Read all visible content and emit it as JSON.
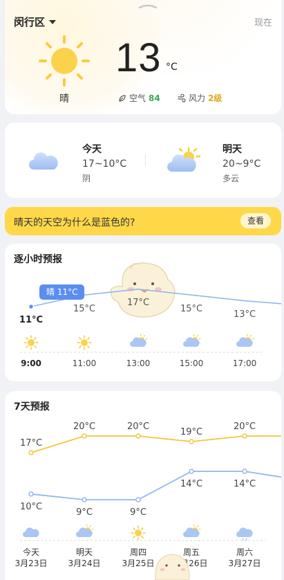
{
  "current": {
    "location": "闵行区",
    "now_label": "现在",
    "temperature": "13",
    "unit": "°C",
    "condition": "晴",
    "air_label": "空气",
    "air_value": "84",
    "wind_label": "风力",
    "wind_value": "2级",
    "colors": {
      "air": "#3aa855",
      "wind": "#e3a518"
    }
  },
  "today": {
    "title": "今天",
    "range": "17~10°C",
    "condition": "阴",
    "icon": "cloud-icon"
  },
  "tomorrow": {
    "title": "明天",
    "range": "20~9°C",
    "condition": "多云",
    "icon": "partly-cloudy-icon"
  },
  "banner": {
    "text": "晴天的天空为什么是蓝色的?",
    "button": "查看"
  },
  "hourly": {
    "title": "逐小时预报",
    "tooltip": "晴 11°C",
    "chart_data": {
      "type": "line",
      "x": [
        "9:00",
        "11:00",
        "13:00",
        "15:00",
        "17:00"
      ],
      "series": [
        {
          "values": [
            11,
            15,
            17,
            15,
            13
          ]
        }
      ],
      "labels": [
        "11°C",
        "15°C",
        "17°C",
        "15°C",
        "13°C"
      ],
      "icons": [
        "sun-icon",
        "sun-icon",
        "partly-cloudy-icon",
        "partly-cloudy-icon",
        "partly-cloudy-icon"
      ]
    }
  },
  "weekly": {
    "title": "7天预报",
    "chart_data": {
      "type": "line",
      "days": [
        "今天",
        "明天",
        "周四",
        "周五",
        "周六"
      ],
      "dates": [
        "3月23日",
        "3月24日",
        "3月25日",
        "3月26日",
        "3月27日"
      ],
      "series": [
        {
          "values": [
            17,
            20,
            20,
            19,
            20
          ],
          "labels": [
            "17°C",
            "20°C",
            "20°C",
            "19°C",
            "20°C"
          ]
        },
        {
          "values": [
            10,
            9,
            9,
            14,
            14
          ],
          "labels": [
            "10°C",
            "9°C",
            "9°C",
            "14°C",
            "14°C"
          ]
        }
      ],
      "colors": {
        "high": "#f5c53d",
        "low": "#8fb7f2"
      },
      "icons": [
        "cloud-icon",
        "partly-cloudy-icon",
        "sun-icon",
        "partly-cloudy-icon",
        "rain-cloud-icon"
      ]
    }
  }
}
